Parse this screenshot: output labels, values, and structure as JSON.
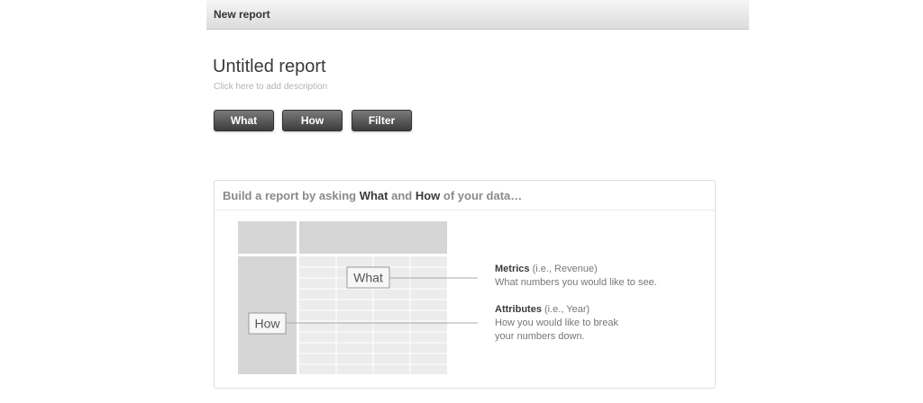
{
  "header": {
    "title": "New report"
  },
  "report": {
    "title": "Untitled report",
    "description_placeholder": "Click here to add description"
  },
  "toolbar": {
    "buttons": [
      {
        "label": "What"
      },
      {
        "label": "How"
      },
      {
        "label": "Filter"
      }
    ]
  },
  "panel": {
    "heading_prefix": "Build a report by asking ",
    "heading_what": "What",
    "heading_and": " and ",
    "heading_how": "How",
    "heading_suffix": " of your data…",
    "diagram": {
      "what_label": "What",
      "how_label": "How"
    },
    "metrics": {
      "title": "Metrics",
      "example": " (i.e., Revenue)",
      "description": "What numbers you would like to see."
    },
    "attributes": {
      "title": "Attributes",
      "example": " (i.e., Year)",
      "description_line1": "How you would like to break",
      "description_line2": "your numbers down."
    }
  }
}
